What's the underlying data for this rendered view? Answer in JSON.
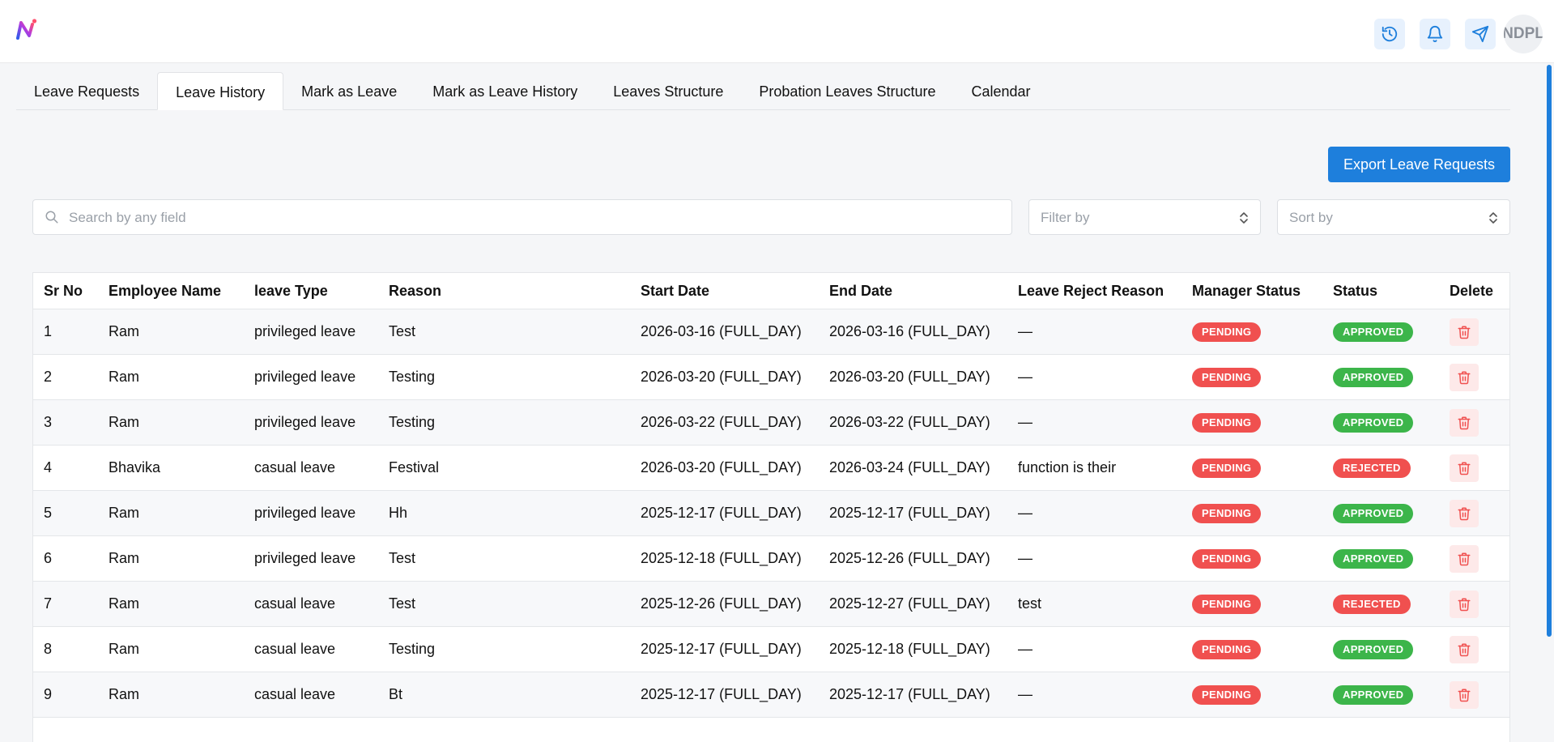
{
  "header": {
    "logo_icon": "brand-logo-icon",
    "actions": [
      {
        "name": "history-icon",
        "color": "#1e7fdc"
      },
      {
        "name": "bell-icon",
        "color": "#1e7fdc"
      },
      {
        "name": "send-icon",
        "color": "#1e7fdc"
      }
    ],
    "avatar_text": "NDPL"
  },
  "tabs": [
    {
      "label": "Leave Requests",
      "active": false
    },
    {
      "label": "Leave History",
      "active": true
    },
    {
      "label": "Mark as Leave",
      "active": false
    },
    {
      "label": "Mark as Leave History",
      "active": false
    },
    {
      "label": "Leaves Structure",
      "active": false
    },
    {
      "label": "Probation Leaves Structure",
      "active": false
    },
    {
      "label": "Calendar",
      "active": false
    }
  ],
  "toolbar": {
    "export_label": "Export Leave Requests",
    "search_placeholder": "Search by any field",
    "filter_placeholder": "Filter by",
    "sort_placeholder": "Sort by"
  },
  "table": {
    "columns": [
      "Sr No",
      "Employee Name",
      "leave Type",
      "Reason",
      "Start Date",
      "End Date",
      "Leave Reject Reason",
      "Manager Status",
      "Status",
      "Delete"
    ],
    "rows": [
      {
        "sr": "1",
        "name": "Ram",
        "type": "privileged leave",
        "reason": "Test",
        "start": "2026-03-16 (FULL_DAY)",
        "end": "2026-03-16 (FULL_DAY)",
        "reject_reason": "—",
        "manager_status": "PENDING",
        "status": "APPROVED"
      },
      {
        "sr": "2",
        "name": "Ram",
        "type": "privileged leave",
        "reason": "Testing",
        "start": "2026-03-20 (FULL_DAY)",
        "end": "2026-03-20 (FULL_DAY)",
        "reject_reason": "—",
        "manager_status": "PENDING",
        "status": "APPROVED"
      },
      {
        "sr": "3",
        "name": "Ram",
        "type": "privileged leave",
        "reason": "Testing",
        "start": "2026-03-22 (FULL_DAY)",
        "end": "2026-03-22 (FULL_DAY)",
        "reject_reason": "—",
        "manager_status": "PENDING",
        "status": "APPROVED"
      },
      {
        "sr": "4",
        "name": "Bhavika",
        "type": "casual leave",
        "reason": "Festival",
        "start": "2026-03-20 (FULL_DAY)",
        "end": "2026-03-24 (FULL_DAY)",
        "reject_reason": "function is their",
        "manager_status": "PENDING",
        "status": "REJECTED"
      },
      {
        "sr": "5",
        "name": "Ram",
        "type": "privileged leave",
        "reason": "Hh",
        "start": "2025-12-17 (FULL_DAY)",
        "end": "2025-12-17 (FULL_DAY)",
        "reject_reason": "—",
        "manager_status": "PENDING",
        "status": "APPROVED"
      },
      {
        "sr": "6",
        "name": "Ram",
        "type": "privileged leave",
        "reason": "Test",
        "start": "2025-12-18 (FULL_DAY)",
        "end": "2025-12-26 (FULL_DAY)",
        "reject_reason": "—",
        "manager_status": "PENDING",
        "status": "APPROVED"
      },
      {
        "sr": "7",
        "name": "Ram",
        "type": "casual leave",
        "reason": "Test",
        "start": "2025-12-26 (FULL_DAY)",
        "end": "2025-12-27 (FULL_DAY)",
        "reject_reason": "test",
        "manager_status": "PENDING",
        "status": "REJECTED"
      },
      {
        "sr": "8",
        "name": "Ram",
        "type": "casual leave",
        "reason": "Testing",
        "start": "2025-12-17 (FULL_DAY)",
        "end": "2025-12-18 (FULL_DAY)",
        "reject_reason": "—",
        "manager_status": "PENDING",
        "status": "APPROVED"
      },
      {
        "sr": "9",
        "name": "Ram",
        "type": "casual leave",
        "reason": "Bt",
        "start": "2025-12-17 (FULL_DAY)",
        "end": "2025-12-17 (FULL_DAY)",
        "reject_reason": "—",
        "manager_status": "PENDING",
        "status": "APPROVED"
      }
    ]
  },
  "colors": {
    "accent": "#1e7fdc",
    "pending": "#f0504f",
    "approved": "#3cb54a",
    "rejected": "#f0504f",
    "delete": "#f0504f"
  }
}
